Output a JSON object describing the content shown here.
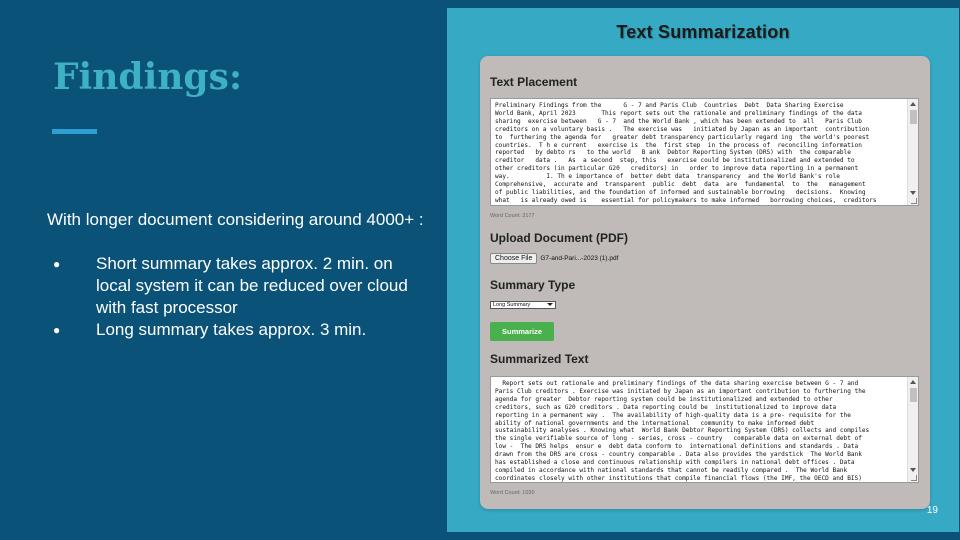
{
  "slide": {
    "title": "Findings:",
    "intro": "With longer document  considering around 4000+ :",
    "bullets": [
      " Short summary takes approx. 2 min. on local system it can be reduced over cloud with fast processor",
      "Long summary takes approx. 3 min."
    ],
    "page_number": "19"
  },
  "app": {
    "title": "Text Summarization",
    "text_placement": {
      "label": "Text Placement",
      "content": "Preliminary Findings from the      G - 7 and Paris Club  Countries  Debt  Data Sharing Exercise\nWorld Bank, April 2023       This report sets out the rationale and preliminary findings of the data\nsharing  exercise between   G - 7  and the World Bank , which has been extended to  all   Paris Club\ncreditors on a voluntary basis .   The exercise was   initiated by Japan as an important  contribution\nto  furthering the agenda for   greater debt transparency particularly regard ing  the world's poorest\ncountries.  T h e current   exercise is  the  first step  in the process of  reconciling information\nreported   by debto rs   to the world   B ank  Debtor Reporting System (DRS) with  the comparable\ncreditor   data .   As  a second  step, this   exercise could be institutionalized and extended to\nother creditors (in particular G20   creditors) in   order to improve data reporting in a permanent\nway.          I. Th e importance of  better debt data  transparency  and the World Bank's role\nComprehensive,  accurate and  transparent  public  debt  data  are  fundamental  to  the   management\nof public liabilities, and the foundation of informed and sustainable borrowing   decisions.  Knowing\nwhat   is already owed is    essential for policymakers to make informed   borrowing choices,  creditors\nto appropriately price for sovereign risk, and citizens to hold their   governments accountable.",
      "word_count": "Word Count: 3177"
    },
    "upload": {
      "label": "Upload Document (PDF)",
      "button": "Choose File",
      "file_name": "G7-and-Pari...-2023 (1).pdf"
    },
    "summary_type": {
      "label": "Summary Type",
      "selected": "Long Summary"
    },
    "summarize_button": "Summarize",
    "summarized_text": {
      "label": "Summarized Text",
      "content": "  Report sets out rationale and preliminary findings of the data sharing exercise between G - 7 and\nParis Club creditors . Exercise was initiated by Japan as an important contribution to furthering the\nagenda for greater  Debtor reporting system could be institutionalized and extended to other\ncreditors, such as G20 creditors . Data reporting could be  institutionalized to improve data\nreporting in a permanent way .  The availability of high-quality data is a pre- requisite for the\nability of national governments and the international   community to make informed debt\nsustainability analyses . Knowing what  World Bank Debtor Reporting System (DRS) collects and compiles\nthe single verifiable source of long - series, cross - country   comparable data on external debt of\nlow -  The DRS helps  ensur e  debt data conform to  international definitions and standards . Data\ndrawn from the DRS are cross - country comparable . Data also provides the yardstick  The World Bank\nhas established a close and continuous relationship with compilers in national debt offices . Data\ncompiled in accordance with national standards that cannot be readily compared .  The World Bank\ncoordinates closely with other institutions that compile financial flows (the IMF, the OECD and BIS)\nand with the Common with   Secretariat (ComSec) and UNCT  Borrowers and creditors have a critical",
      "word_count": "Word Count: 1030"
    }
  }
}
